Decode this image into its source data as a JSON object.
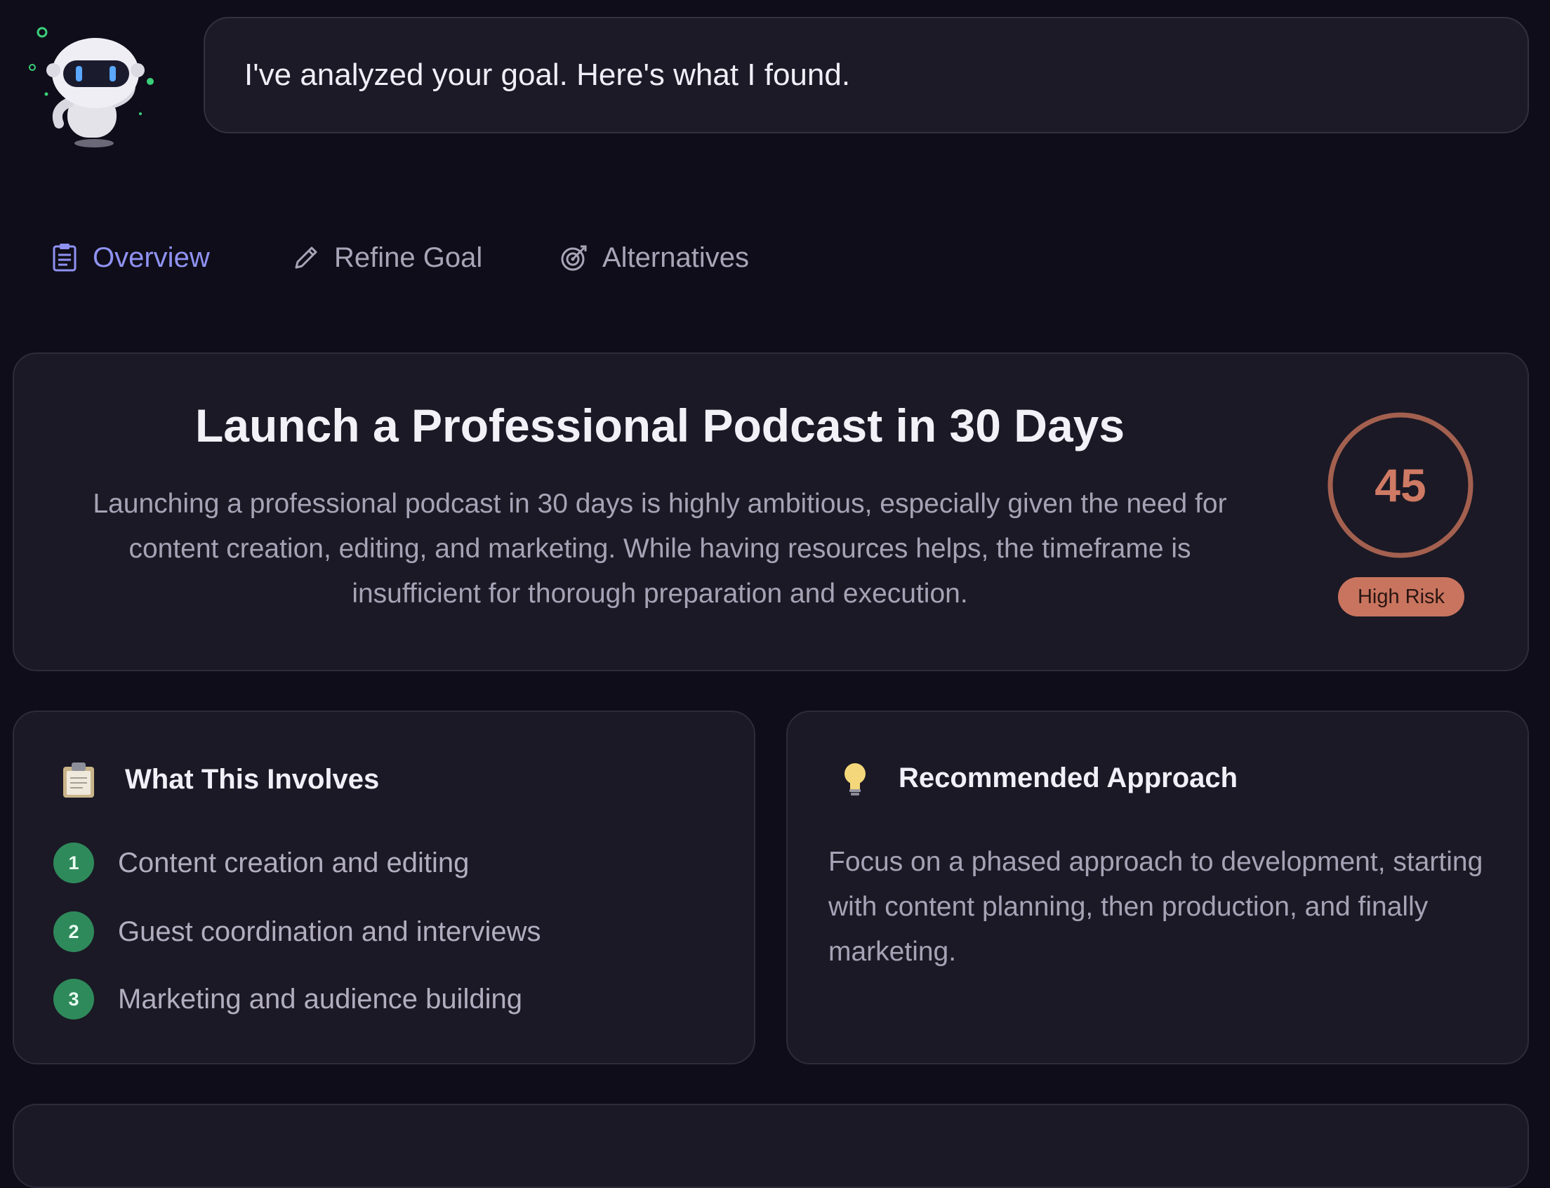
{
  "assistant": {
    "message": "I've analyzed your goal. Here's what I found.",
    "avatar_icon": "robot-icon"
  },
  "tabs": [
    {
      "label": "Overview",
      "icon": "clipboard-icon",
      "active": true
    },
    {
      "label": "Refine Goal",
      "icon": "pencil-icon",
      "active": false
    },
    {
      "label": "Alternatives",
      "icon": "target-icon",
      "active": false
    }
  ],
  "overview": {
    "title": "Launch a Professional Podcast in 30 Days",
    "description": "Launching a professional podcast in 30 days is highly ambitious, especially given the need for content creation, editing, and marketing. While having resources helps, the timeframe is insufficient for thorough preparation and execution.",
    "score": "45",
    "risk_label": "High Risk"
  },
  "involves": {
    "title": "What This Involves",
    "icon": "clipboard-icon",
    "items": [
      {
        "num": "1",
        "text": "Content creation and editing"
      },
      {
        "num": "2",
        "text": "Guest coordination and interviews"
      },
      {
        "num": "3",
        "text": "Marketing and audience building"
      }
    ]
  },
  "approach": {
    "title": "Recommended Approach",
    "icon": "lightbulb-icon",
    "text": "Focus on a phased approach to development, starting with content planning, then production, and finally marketing."
  },
  "colors": {
    "background": "#0f0d19",
    "card": "#1b1925",
    "accent": "#8f92f2",
    "risk": "#c9745f",
    "step": "#2f8a5b"
  }
}
